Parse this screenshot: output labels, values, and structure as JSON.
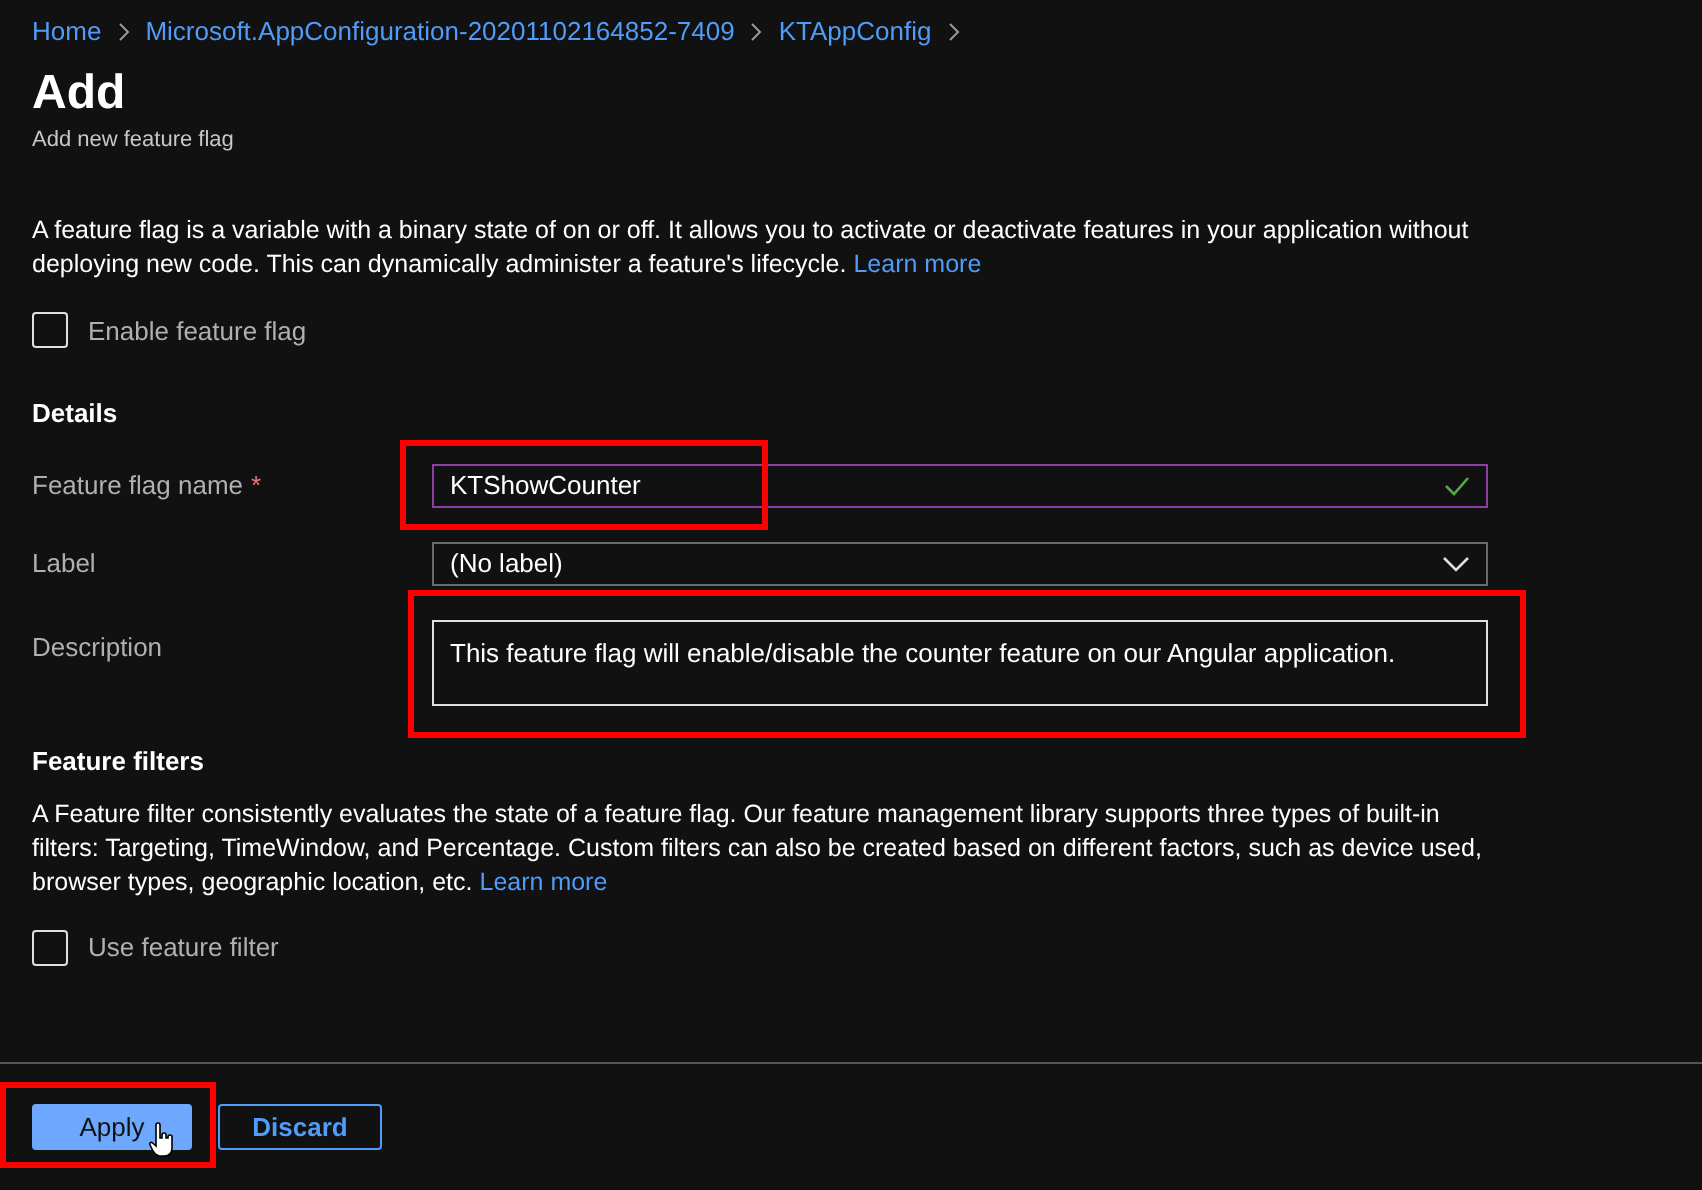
{
  "breadcrumb": [
    {
      "label": "Home"
    },
    {
      "label": "Microsoft.AppConfiguration-20201102164852-7409"
    },
    {
      "label": "KTAppConfig"
    }
  ],
  "title": "Add",
  "subtitle": "Add new feature flag",
  "intro": {
    "text": "A feature flag is a variable with a binary state of on or off. It allows you to activate or deactivate features in your application without deploying new code. This can dynamically administer a feature's lifecycle.",
    "link": "Learn more"
  },
  "enable_checkbox": {
    "label": "Enable feature flag",
    "checked": false
  },
  "details": {
    "heading": "Details",
    "fields": [
      {
        "kind": "text",
        "label": "Feature flag name",
        "required_mark": "*",
        "value": "KTShowCounter",
        "valid": true,
        "highlighted": true
      },
      {
        "kind": "dropdown",
        "label": "Label",
        "value": "(No label)",
        "highlighted": false
      },
      {
        "kind": "textarea",
        "label": "Description",
        "value": "This feature flag will enable/disable the counter feature on our Angular application.",
        "highlighted": true
      }
    ]
  },
  "filters": {
    "heading": "Feature filters",
    "text": "A Feature filter consistently evaluates the state of a feature flag. Our feature management library supports three types of built-in filters: Targeting, TimeWindow, and Percentage. Custom filters can also be created based on different factors, such as device used, browser types, geographic location, etc.",
    "link": "Learn more",
    "checkbox": {
      "label": "Use feature filter",
      "checked": false
    }
  },
  "buttons": [
    {
      "label": "Apply",
      "kind": "primary",
      "highlighted": true,
      "hovered": true
    },
    {
      "label": "Discard",
      "kind": "secondary",
      "highlighted": false,
      "hovered": false
    }
  ]
}
